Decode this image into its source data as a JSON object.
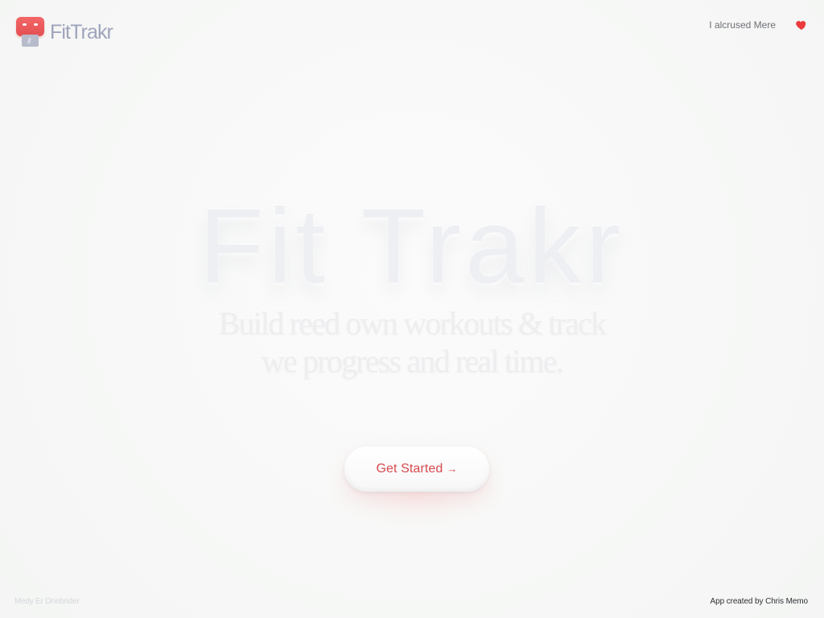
{
  "app": {
    "brand_name": "FitTrakr",
    "logo_icon": "fittrakr-logo-icon"
  },
  "header": {
    "nav_link": "I alcrused Mere",
    "heart_icon": "heart-icon",
    "heart_color": "#ea3b3d"
  },
  "hero": {
    "title": "Fit Trakr",
    "subtitle_line_1": "Build reed own workouts & track",
    "subtitle_line_2": "we progress and real time."
  },
  "cta": {
    "label": "Get Started",
    "arrow": "→",
    "accent_color": "#d74a4e"
  },
  "footer": {
    "left_text": "Medy Er Dnebrider",
    "right_text": "App created by Chris Memo"
  }
}
